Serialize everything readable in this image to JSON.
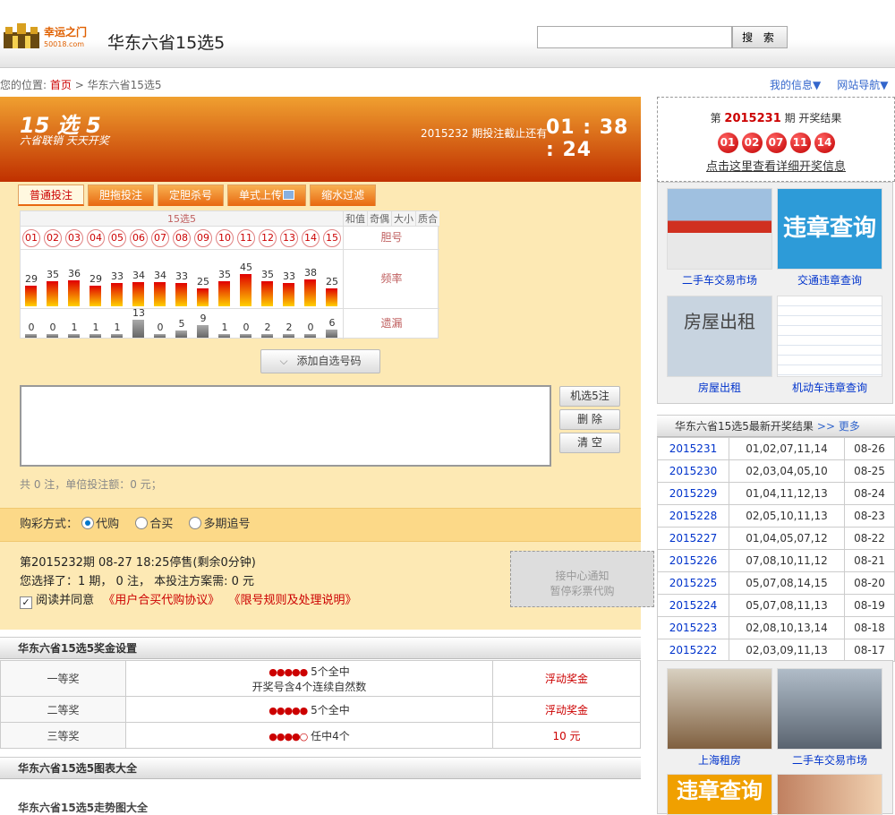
{
  "header": {
    "logo_text": "幸运之门",
    "logo_sub": "50018.com",
    "title": "华东六省15选5",
    "search_placeholder": "",
    "search_button": "搜 索"
  },
  "breadcrumb": {
    "prefix": "您的位置:",
    "home": "首页",
    "sep": ">",
    "current": "华东六省15选5"
  },
  "top_links": [
    "我的信息▼",
    "网站导航▼"
  ],
  "banner": {
    "title": "15 选 5",
    "subtitle": "六省联销 天天开奖",
    "countdown_label": "2015232 期投注截止还有",
    "countdown": "01 : 38 : 24"
  },
  "tabs": [
    {
      "label": "普通投注",
      "active": true
    },
    {
      "label": "胆拖投注",
      "active": false
    },
    {
      "label": "定胆杀号",
      "active": false
    },
    {
      "label": "单式上传",
      "active": false
    },
    {
      "label": "缩水过滤",
      "active": false
    }
  ],
  "grid": {
    "header": "15选5",
    "extra_headers": [
      "和值",
      "奇偶",
      "大小",
      "质合"
    ],
    "numbers": [
      "01",
      "02",
      "03",
      "04",
      "05",
      "06",
      "07",
      "08",
      "09",
      "10",
      "11",
      "12",
      "13",
      "14",
      "15"
    ],
    "row_labels": {
      "pick": "胆号",
      "freq": "频率",
      "miss": "遗漏"
    },
    "frequency": [
      29,
      35,
      36,
      29,
      33,
      34,
      34,
      33,
      25,
      35,
      45,
      35,
      33,
      38,
      25
    ],
    "missing": [
      0,
      0,
      1,
      1,
      1,
      13,
      0,
      5,
      9,
      1,
      0,
      2,
      2,
      0,
      6
    ]
  },
  "add_button": "添加自选号码",
  "side_buttons": [
    "机选5注",
    "删 除",
    "清 空"
  ],
  "bet_summary": "共 0 注，单倍投注额：0 元；",
  "buy_mode": {
    "label": "购彩方式：",
    "options": [
      {
        "label": "代购",
        "on": true
      },
      {
        "label": "合买",
        "on": false
      },
      {
        "label": "多期追号",
        "on": false
      }
    ]
  },
  "info": {
    "line1": "第2015232期 08-27 18:25停售(剩余0分钟)",
    "line2": "您选择了：1 期， 0 注， 本投注方案需: 0 元",
    "agree": "阅读并同意",
    "agree_link1": "《用户合买代购协议》",
    "agree_link2": "《限号规则及处理说明》"
  },
  "notice": {
    "line1": "接中心通知",
    "line2": "暂停彩票代购"
  },
  "prize_section": {
    "title": "华东六省15选5奖金设置",
    "rows": [
      {
        "level": "一等奖",
        "balls": "●●●●●",
        "desc": "5个全中",
        "desc2": "开奖号含4个连续自然数",
        "amount": "浮动奖金"
      },
      {
        "level": "二等奖",
        "balls": "●●●●●",
        "desc": "5个全中",
        "desc2": "",
        "amount": "浮动奖金"
      },
      {
        "level": "三等奖",
        "balls": "●●●●○",
        "desc": "任中4个",
        "desc2": "",
        "amount": "10 元"
      }
    ]
  },
  "chart_section": {
    "title": "华东六省15选5图表大全",
    "subtitle": "华东六省15选5走势图大全"
  },
  "right_panel": {
    "prefix": "第",
    "issue": "2015231",
    "suffix": "期  开奖结果",
    "balls": [
      "01",
      "02",
      "07",
      "11",
      "14"
    ],
    "detail_link": "点击这里查看详细开奖信息"
  },
  "ads_top": [
    {
      "caption": "二手车交易市场",
      "bg": "#8aa6c8"
    },
    {
      "caption": "交通违章查询",
      "bg": "#2d9bd8",
      "overlay": "违章查询"
    },
    {
      "caption": "房屋出租",
      "bg": "#c8d4e0",
      "overlay": "房屋出租"
    },
    {
      "caption": "机动车违章查询",
      "bg": "#e8eef6"
    }
  ],
  "results": {
    "title": "华东六省15选5最新开奖结果",
    "more": ">> 更多",
    "rows": [
      {
        "issue": "2015231",
        "nums": "01,02,07,11,14",
        "date": "08-26"
      },
      {
        "issue": "2015230",
        "nums": "02,03,04,05,10",
        "date": "08-25"
      },
      {
        "issue": "2015229",
        "nums": "01,04,11,12,13",
        "date": "08-24"
      },
      {
        "issue": "2015228",
        "nums": "02,05,10,11,13",
        "date": "08-23"
      },
      {
        "issue": "2015227",
        "nums": "01,04,05,07,12",
        "date": "08-22"
      },
      {
        "issue": "2015226",
        "nums": "07,08,10,11,12",
        "date": "08-21"
      },
      {
        "issue": "2015225",
        "nums": "05,07,08,14,15",
        "date": "08-20"
      },
      {
        "issue": "2015224",
        "nums": "05,07,08,11,13",
        "date": "08-19"
      },
      {
        "issue": "2015223",
        "nums": "02,08,10,13,14",
        "date": "08-18"
      },
      {
        "issue": "2015222",
        "nums": "02,03,09,11,13",
        "date": "08-17"
      }
    ]
  },
  "ads_bottom": [
    {
      "caption": "上海租房",
      "bg": "#b09070"
    },
    {
      "caption": "二手车交易市场",
      "bg": "#8c98a8"
    },
    {
      "caption": "",
      "bg": "#f0a000",
      "overlay": "违章查询"
    },
    {
      "caption": "",
      "bg": "#c08060"
    }
  ],
  "colors": {
    "accent": "#e86810",
    "red": "#cc0000",
    "link": "#0033cc"
  }
}
